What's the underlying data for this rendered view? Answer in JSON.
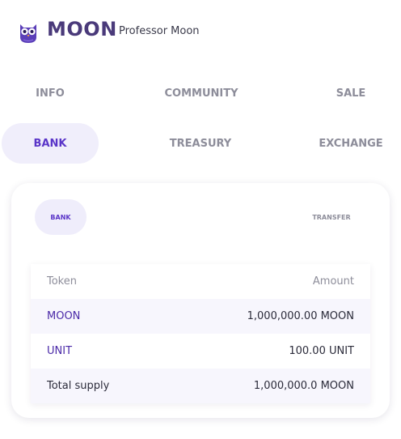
{
  "header": {
    "brand": "MOON",
    "subtitle": "Professor Moon",
    "logo_icon": "owl-icon"
  },
  "nav": {
    "row1": [
      {
        "label": "INFO"
      },
      {
        "label": "COMMUNITY"
      },
      {
        "label": "SALE"
      }
    ],
    "row2": [
      {
        "label": "BANK",
        "active": true
      },
      {
        "label": "TREASURY"
      },
      {
        "label": "EXCHANGE"
      }
    ]
  },
  "card": {
    "tabs": [
      {
        "label": "BANK",
        "active": true
      },
      {
        "label": "TRANSFER"
      }
    ],
    "table": {
      "headers": {
        "token": "Token",
        "amount": "Amount"
      },
      "rows": [
        {
          "token": "MOON",
          "amount": "1,000,000.00 MOON"
        },
        {
          "token": "UNIT",
          "amount": "100.00 UNIT"
        }
      ],
      "total": {
        "label": "Total supply",
        "amount": "1,000,000.0 MOON"
      }
    }
  },
  "colors": {
    "accent": "#5a35c8",
    "active_bg": "#f0eefb",
    "muted": "#8d8d9a"
  }
}
